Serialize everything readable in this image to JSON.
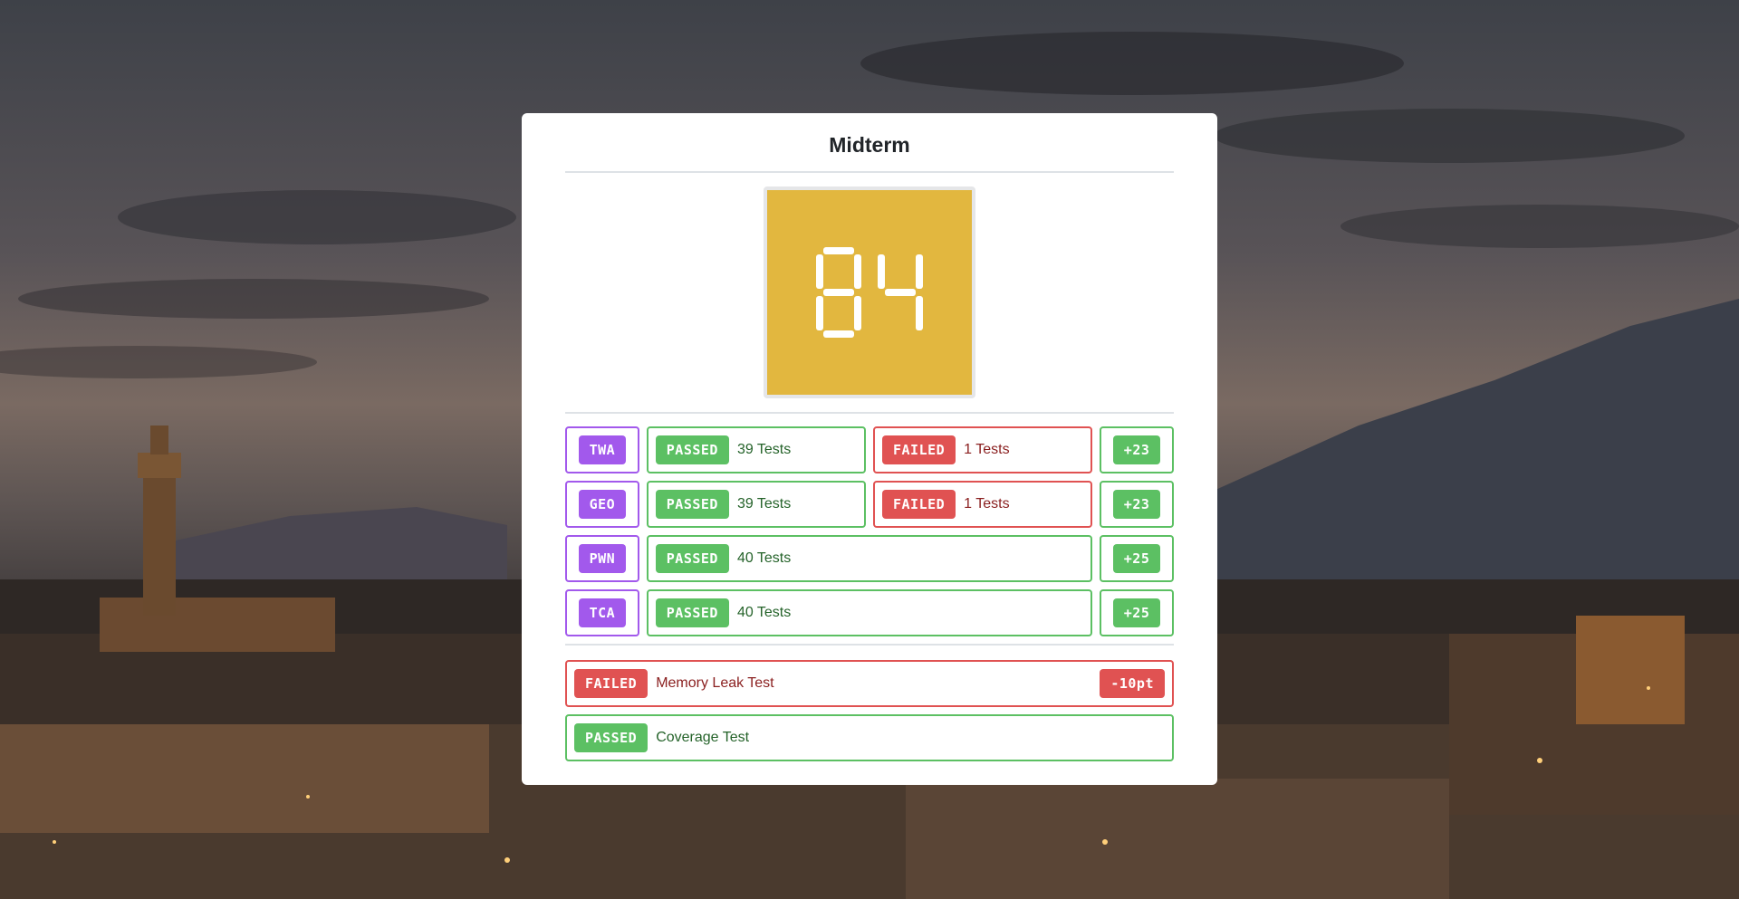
{
  "card": {
    "title": "Midterm"
  },
  "score": {
    "value": "84",
    "background": "#e2b73f"
  },
  "colors": {
    "passed": "#5cc063",
    "failed": "#e05252",
    "code": "#a259ec"
  },
  "modules": [
    {
      "code": "TWA",
      "passed_label": "PASSED",
      "passed_text": "39 Tests",
      "failed_label": "FAILED",
      "failed_text": "1 Tests",
      "points": "+23"
    },
    {
      "code": "GEO",
      "passed_label": "PASSED",
      "passed_text": "39 Tests",
      "failed_label": "FAILED",
      "failed_text": "1 Tests",
      "points": "+23"
    },
    {
      "code": "PWN",
      "passed_label": "PASSED",
      "passed_text": "40 Tests",
      "points": "+25"
    },
    {
      "code": "TCA",
      "passed_label": "PASSED",
      "passed_text": "40 Tests",
      "points": "+25"
    }
  ],
  "extra_tests": [
    {
      "status": "FAILED",
      "name": "Memory Leak Test",
      "points": "-10pt"
    },
    {
      "status": "PASSED",
      "name": "Coverage Test"
    }
  ]
}
